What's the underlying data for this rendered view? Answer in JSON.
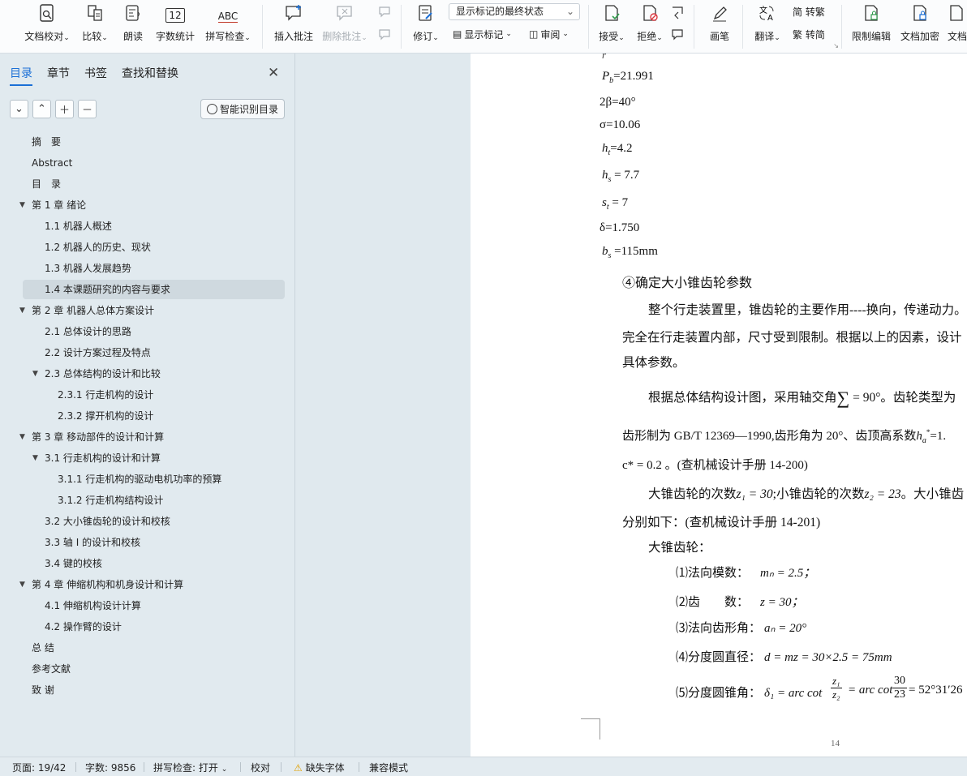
{
  "ribbon": {
    "compare_group": [
      {
        "label": "文档校对",
        "icon": "doc-proofread-icon"
      },
      {
        "label": "比较",
        "icon": "compare-icon"
      },
      {
        "label": "朗读",
        "icon": "read-aloud-icon"
      },
      {
        "label": "字数统计",
        "icon": "word-count-icon",
        "glyph": "12"
      },
      {
        "label": "拼写检查",
        "icon": "spell-check-icon",
        "glyph": "ABC"
      }
    ],
    "comment_group": {
      "insert": "插入批注",
      "delete": "删除批注"
    },
    "revise": {
      "label": "修订",
      "display_state": "显示标记的最终状态",
      "show_markup": "显示标记",
      "review": "审阅"
    },
    "accept": "接受",
    "reject": "拒绝",
    "pen": "画笔",
    "translate": "翻译",
    "to_traditional": "简 转繁",
    "to_simplified": "繁 转简",
    "restrict_edit": "限制编辑",
    "doc_encrypt": "文档加密",
    "doc_more": "文档"
  },
  "nav": {
    "tabs": [
      "目录",
      "章节",
      "书签",
      "查找和替换"
    ],
    "active_tab": 0,
    "ai_button": "智能识别目录",
    "toc": [
      {
        "label": "摘　要",
        "level": 1,
        "toggle": ""
      },
      {
        "label": "Abstract",
        "level": 1,
        "toggle": ""
      },
      {
        "label": "目　录",
        "level": 1,
        "toggle": ""
      },
      {
        "label": "第 1 章  绪论",
        "level": 1,
        "toggle": "▼"
      },
      {
        "label": "1.1  机器人概述",
        "level": 2,
        "toggle": ""
      },
      {
        "label": "1.2  机器人的历史、现状",
        "level": 2,
        "toggle": ""
      },
      {
        "label": "1.3 机器人发展趋势",
        "level": 2,
        "toggle": ""
      },
      {
        "label": "1.4  本课题研究的内容与要求",
        "level": 2,
        "toggle": "",
        "selected": true
      },
      {
        "label": "第 2 章  机器人总体方案设计",
        "level": 1,
        "toggle": "▼"
      },
      {
        "label": "2.1 总体设计的思路",
        "level": 2,
        "toggle": ""
      },
      {
        "label": "2.2  设计方案过程及特点",
        "level": 2,
        "toggle": ""
      },
      {
        "label": "2.3  总体结构的设计和比较",
        "level": 2,
        "toggle": "▼"
      },
      {
        "label": "2.3.1  行走机构的设计",
        "level": 3,
        "toggle": ""
      },
      {
        "label": "2.3.2  撑开机构的设计",
        "level": 3,
        "toggle": ""
      },
      {
        "label": "第 3 章  移动部件的设计和计算",
        "level": 1,
        "toggle": "▼"
      },
      {
        "label": "3.1  行走机构的设计和计算",
        "level": 2,
        "toggle": "▼"
      },
      {
        "label": "3.1.1  行走机构的驱动电机功率的预算",
        "level": 3,
        "toggle": ""
      },
      {
        "label": "3.1.2  行走机构结构设计",
        "level": 3,
        "toggle": ""
      },
      {
        "label": "3.2 大小锥齿轮的设计和校核",
        "level": 2,
        "toggle": ""
      },
      {
        "label": "3.3  轴 I 的设计和校核",
        "level": 2,
        "toggle": ""
      },
      {
        "label": "3.4  键的校核",
        "level": 2,
        "toggle": ""
      },
      {
        "label": "第 4 章  伸缩机构和机身设计和计算",
        "level": 1,
        "toggle": "▼"
      },
      {
        "label": "4.1  伸缩机构设计计算",
        "level": 2,
        "toggle": ""
      },
      {
        "label": "4.2  操作臂的设计",
        "level": 2,
        "toggle": ""
      },
      {
        "label": "总  结",
        "level": 1,
        "toggle": ""
      },
      {
        "label": "参考文献",
        "level": 1,
        "toggle": ""
      },
      {
        "label": "致  谢",
        "level": 1,
        "toggle": ""
      }
    ]
  },
  "doc": {
    "params": [
      {
        "sym": "P",
        "sub": "b",
        "rest": "=21.991"
      },
      {
        "sym": "",
        "sub": "",
        "rest": "2β=40°"
      },
      {
        "sym": "",
        "sub": "",
        "rest": "σ=10.06"
      },
      {
        "sym": "h",
        "sub": "t",
        "rest": "=4.2"
      },
      {
        "sym": "h",
        "sub": "s",
        "rest": " = 7.7"
      },
      {
        "sym": "s",
        "sub": "t",
        "rest": " = 7"
      },
      {
        "sym": "",
        "sub": "",
        "rest": "δ=1.750"
      },
      {
        "sym": "b",
        "sub": "s",
        "rest": " =115mm"
      }
    ],
    "heading": "④确定大小锥齿轮参数",
    "p1": "整个行走装置里，锥齿轮的主要作用----换向，传递动力。",
    "p1b": "完全在行走装置内部，尺寸受到限制。根据以上的因素，设计",
    "p1c": "具体参数。",
    "p2": "根据总体结构设计图，采用轴交角",
    "p2b": " = 90°。齿轮类型为",
    "p3": "齿形制为 GB/T 12369—1990,齿形角为 20°、齿顶高系数",
    "p3b": "=1.",
    "p4": "c* = 0.2 。(查机械设计手册 14-200)",
    "p5": "大锥齿轮的次数",
    "p5z1": "z₁ = 30",
    "p5mid": ";小锥齿轮的次数",
    "p5z2": "z₂ = 23",
    "p5end": "。大小锥齿",
    "p6": "分别如下：(查机械设计手册 14-201)",
    "big_gear": "大锥齿轮：",
    "items": [
      {
        "label": "⑴法向模数：",
        "formula": "mₙ = 2.5；"
      },
      {
        "label": "⑵齿　　数：",
        "formula": "z = 30；"
      },
      {
        "label": "⑶法向齿形角：",
        "formula": "aₙ = 20°"
      },
      {
        "label": "⑷分度圆直径：",
        "formula": "d = mz = 30×2.5 = 75mm"
      },
      {
        "label": "⑸分度圆锥角：",
        "formula": "δ₁ = arc cot"
      }
    ],
    "frac1_num": "z₁",
    "frac1_den": "z₂",
    "frac2_num": "30",
    "frac2_den": "23",
    "angle_result": "= 52°31′26",
    "page_number": "14"
  },
  "status": {
    "page": "页面: 19/42",
    "words": "字数: 9856",
    "spell": "拼写检查: 打开",
    "proof": "校对",
    "missing_font": "缺失字体",
    "compat": "兼容模式"
  }
}
